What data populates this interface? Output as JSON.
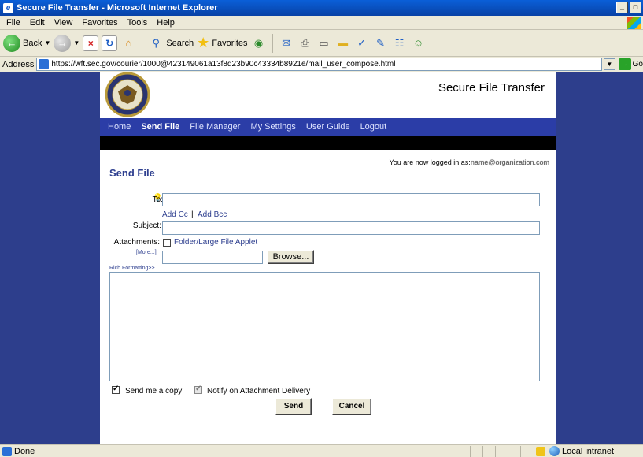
{
  "window": {
    "title": "Secure File Transfer - Microsoft Internet Explorer",
    "controls": [
      "_",
      "□",
      "×"
    ]
  },
  "menu": {
    "items": [
      "File",
      "Edit",
      "View",
      "Favorites",
      "Tools",
      "Help"
    ]
  },
  "toolbar": {
    "back": "Back",
    "search": "Search",
    "favorites": "Favorites"
  },
  "address": {
    "label": "Address",
    "url": "https://wft.sec.gov/courier/1000@423149061a13f8d23b90c43334b8921e/mail_user_compose.html",
    "go": "Go"
  },
  "header": {
    "brand": "Secure File Transfer"
  },
  "nav": {
    "items": [
      "Home",
      "Send File",
      "File Manager",
      "My Settings",
      "User Guide",
      "Logout"
    ],
    "active": "Send File"
  },
  "login": {
    "prefix": "You are now logged in as:",
    "user": "name@organization.com"
  },
  "form": {
    "title": "Send File",
    "to_label": "To:",
    "add_cc": "Add Cc",
    "add_separator": "|",
    "add_bcc": "Add Bcc",
    "subject_label": "Subject:",
    "attachments_label": "Attachments:",
    "applet_label": "Folder/Large File Applet",
    "more_link": "[More...]",
    "browse": "Browse...",
    "rich_formatting": "Rich Formatting>>",
    "send_copy_label": "Send me a copy",
    "send_copy_checked": true,
    "notify_label": "Notify on Attachment Delivery",
    "notify_checked": true,
    "send_button": "Send",
    "cancel_button": "Cancel"
  },
  "status": {
    "text": "Done",
    "zone": "Local intranet"
  }
}
